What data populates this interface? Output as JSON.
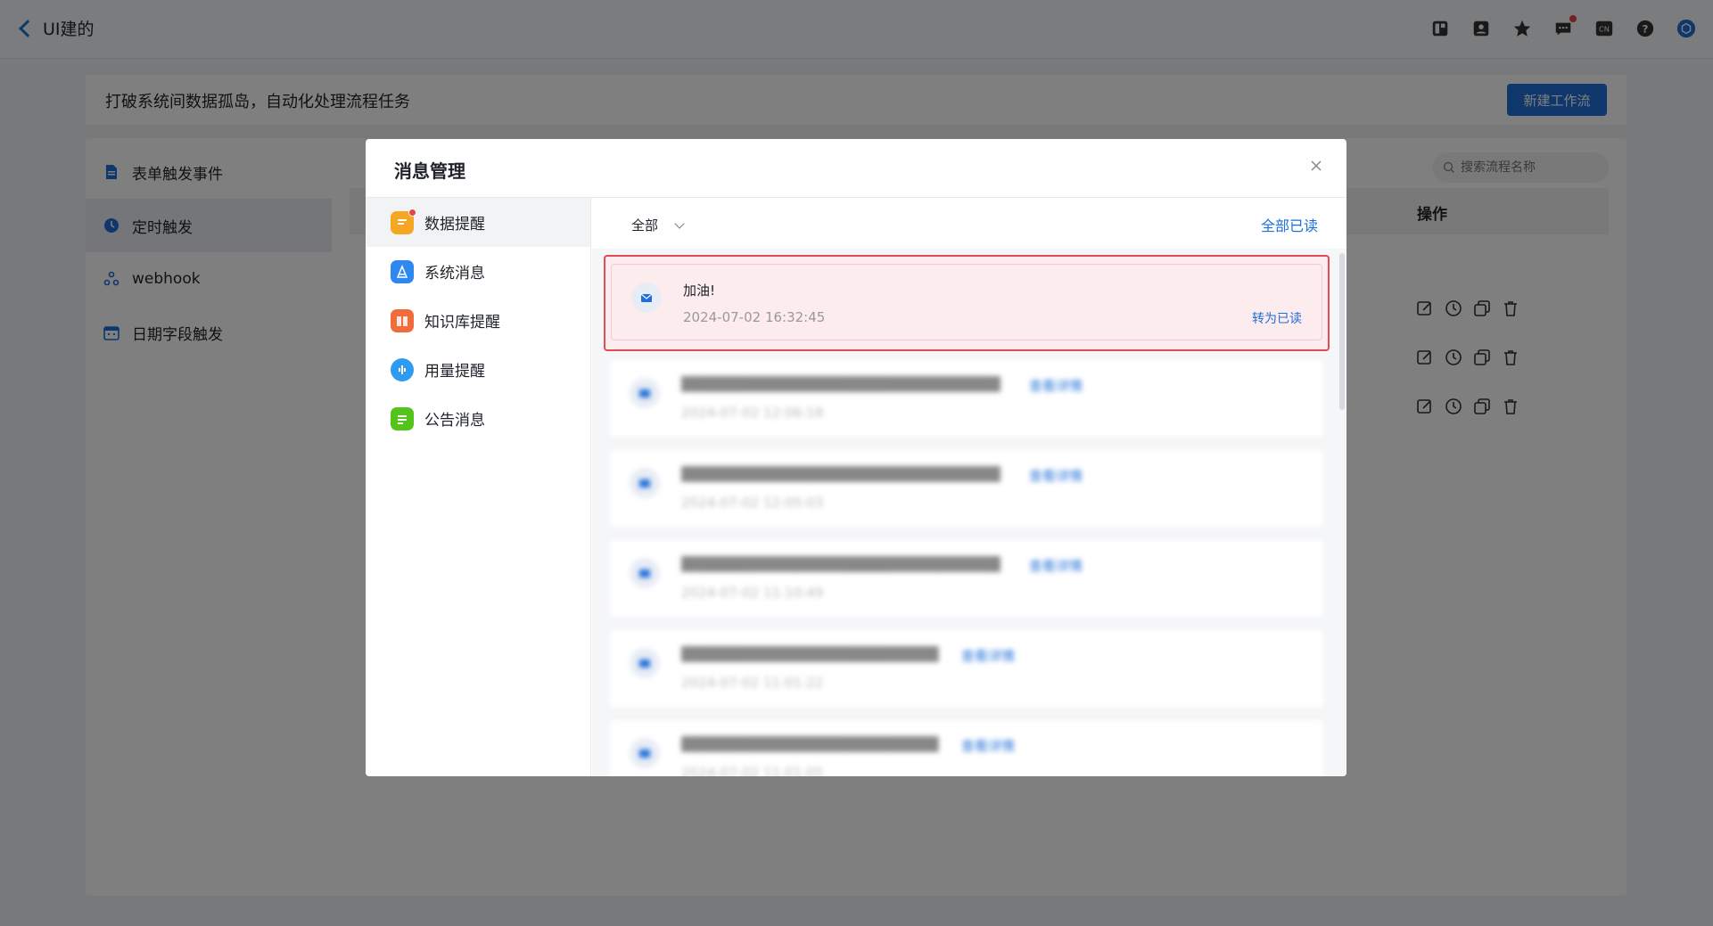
{
  "topbar": {
    "back_label": "UI建的",
    "icons": [
      "layout-icon",
      "contact-icon",
      "star-icon",
      "message-icon",
      "language-icon",
      "help-icon",
      "avatar-icon"
    ],
    "language_badge": "CN"
  },
  "banner": {
    "text": "打破系统间数据孤岛，自动化处理流程任务",
    "new_button": "新建工作流"
  },
  "sidenav": {
    "items": [
      {
        "label": "表单触发事件",
        "icon": "form-icon"
      },
      {
        "label": "定时触发",
        "icon": "clock-icon"
      },
      {
        "label": "webhook",
        "icon": "webhook-icon"
      },
      {
        "label": "日期字段触发",
        "icon": "calendar-icon"
      }
    ]
  },
  "search": {
    "placeholder": "搜索流程名称"
  },
  "table": {
    "ops_header": "操作"
  },
  "modal": {
    "title": "消息管理",
    "categories": [
      {
        "label": "数据提醒",
        "color": "#f5a623"
      },
      {
        "label": "系统消息",
        "color": "#2f88f0"
      },
      {
        "label": "知识库提醒",
        "color": "#f26b3a"
      },
      {
        "label": "用量提醒",
        "color": "#2f9bf0"
      },
      {
        "label": "公告消息",
        "color": "#52c41a"
      }
    ],
    "filter": "全部",
    "read_all": "全部已读",
    "messages": [
      {
        "text": "加油!",
        "time": "2024-07-02 16:32:45",
        "action": "转为已读"
      }
    ],
    "blurred_messages": [
      {
        "text": "███████████████████████████████",
        "time": "2024-07-02 12:06:18",
        "link": "查看详情"
      },
      {
        "text": "███████████████████████████████",
        "time": "2024-07-02 12:05:03",
        "link": "查看详情"
      },
      {
        "text": "███████████████████████████████",
        "time": "2024-07-02 11:10:49",
        "link": "查看详情"
      },
      {
        "text": "█████████████████████████",
        "time": "2024-07-02 11:01:22",
        "link": "查看详情"
      },
      {
        "text": "█████████████████████████",
        "time": "2024-07-02 11:01:05",
        "link": "查看详情"
      }
    ]
  }
}
